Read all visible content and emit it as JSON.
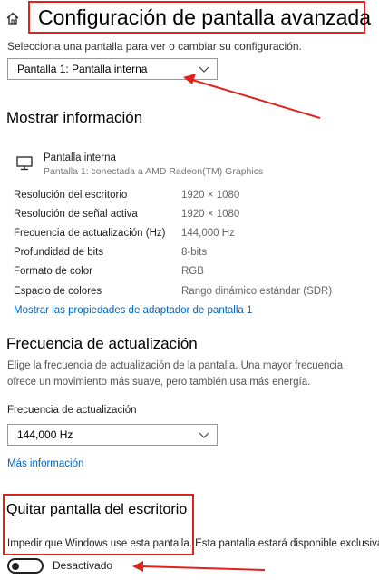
{
  "header": {
    "title": "Configuración de pantalla avanzada",
    "subtitle": "Selecciona una pantalla para ver o cambiar su configuración."
  },
  "display_select": {
    "value": "Pantalla 1: Pantalla interna"
  },
  "info": {
    "heading": "Mostrar información",
    "monitor_name": "Pantalla interna",
    "monitor_sub": "Pantalla 1: conectada a AMD Radeon(TM) Graphics",
    "rows": [
      {
        "label": "Resolución del escritorio",
        "value": "1920 × 1080"
      },
      {
        "label": "Resolución de señal activa",
        "value": "1920 × 1080"
      },
      {
        "label": "Frecuencia de actualización (Hz)",
        "value": "144,000 Hz"
      },
      {
        "label": "Profundidad de bits",
        "value": "8-bits"
      },
      {
        "label": "Formato de color",
        "value": "RGB"
      },
      {
        "label": "Espacio de colores",
        "value": "Rango dinámico estándar (SDR)"
      }
    ],
    "adapter_link": "Mostrar las propiedades de adaptador de pantalla 1"
  },
  "refresh": {
    "heading": "Frecuencia de actualización",
    "description": "Elige la frecuencia de actualización de la pantalla. Una mayor frecuencia ofrece un movimiento más suave, pero también usa más energía.",
    "field_label": "Frecuencia de actualización",
    "select_value": "144,000 Hz",
    "more_info": "Más información"
  },
  "remove": {
    "heading": "Quitar pantalla del escritorio",
    "description": "Impedir que Windows use esta pantalla. Esta pantalla estará disponible exclusiva",
    "toggle_state": "Desactivado"
  },
  "colors": {
    "annotation": "#e0221c",
    "link": "#0064b8"
  },
  "icons": {
    "home": "home-icon",
    "monitor": "monitor-icon",
    "chevron": "chevron-down-icon"
  }
}
